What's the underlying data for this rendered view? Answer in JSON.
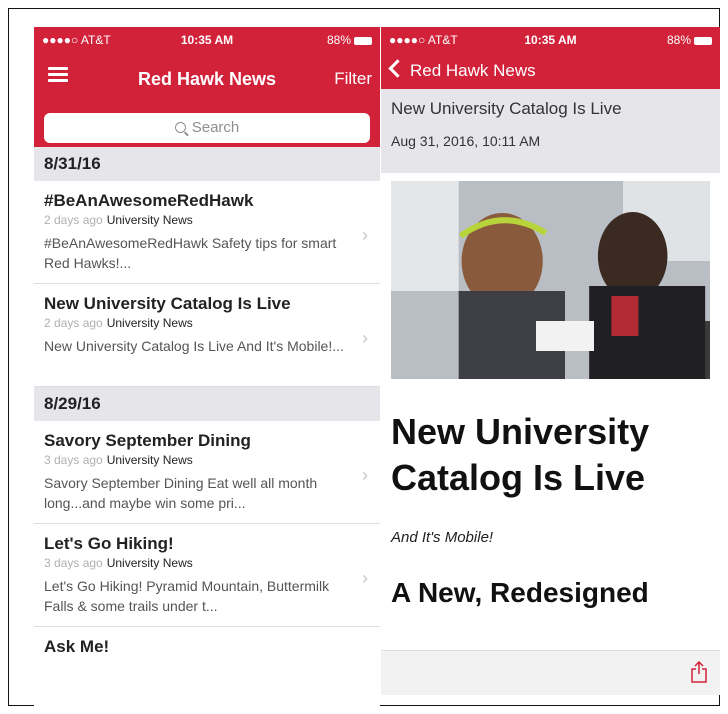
{
  "left": {
    "status": {
      "carrier": "●●●●○ AT&T",
      "time": "10:35 AM",
      "battery": "88%"
    },
    "nav": {
      "title": "Red Hawk News",
      "filter": "Filter"
    },
    "search": {
      "placeholder": "Search"
    },
    "sections": [
      {
        "date": "8/31/16",
        "items": [
          {
            "title": "#BeAnAwesomeRedHawk",
            "ago": "2 days ago",
            "source": "University News",
            "snippet": "#BeAnAwesomeRedHawk  Safety tips for smart Red Hawks!..."
          },
          {
            "title": "New University Catalog Is Live",
            "ago": "2 days ago",
            "source": "University News",
            "snippet": "New University Catalog Is Live  And It's Mobile!..."
          }
        ]
      },
      {
        "date": "8/29/16",
        "items": [
          {
            "title": "Savory September Dining",
            "ago": "3 days ago",
            "source": "University News",
            "snippet": "Savory September Dining  Eat well all month long...and maybe win some pri..."
          },
          {
            "title": "Let's Go Hiking!",
            "ago": "3 days ago",
            "source": "University News",
            "snippet": "Let's Go Hiking!  Pyramid Mountain, Buttermilk Falls & some trails under t..."
          },
          {
            "title": "Ask Me!",
            "ago": "",
            "source": "",
            "snippet": ""
          }
        ]
      }
    ]
  },
  "right": {
    "status": {
      "carrier": "●●●●○ AT&T",
      "time": "10:35 AM",
      "battery": "88%"
    },
    "nav": {
      "back": "Red Hawk News"
    },
    "header": {
      "title": "New University Catalog Is Live",
      "date": "Aug 31, 2016, 10:11 AM"
    },
    "article": {
      "title": "New University Catalog Is Live",
      "subtitle": "And It's Mobile!",
      "heading": "A New, Redesigned University Catalog"
    }
  },
  "colors": {
    "brand_red": "#d1223a",
    "section_gray": "#e5e5ea"
  }
}
